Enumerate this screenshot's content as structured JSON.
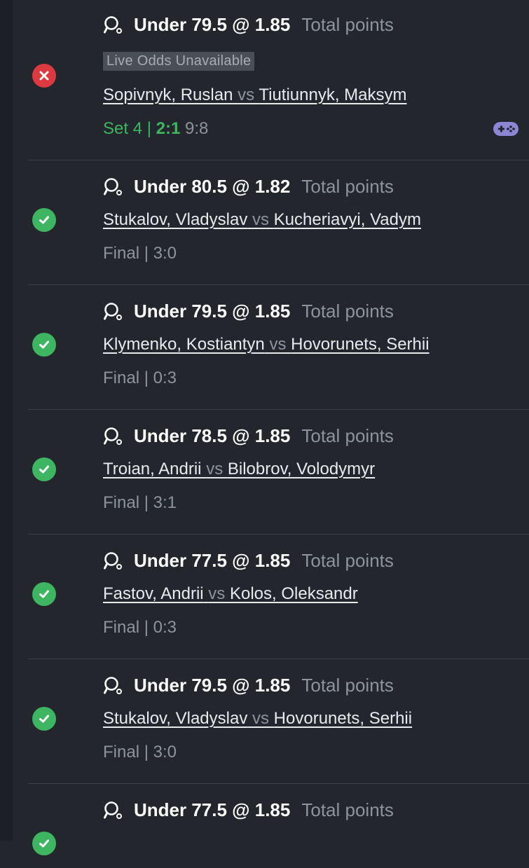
{
  "colors": {
    "won": "#3db561",
    "lost": "#dc3a40",
    "background": "#23262d"
  },
  "icons": {
    "sport": "table-tennis-icon",
    "won": "check-icon",
    "lost": "x-icon",
    "live": "gamepad-icon"
  },
  "bets": [
    {
      "status": "lost",
      "bet": "Under 79.5 @ 1.85",
      "market": "Total points",
      "badge": "Live Odds Unavailable",
      "player1": "Sopivnyk, Ruslan",
      "vs": "vs",
      "player2": "Tiutiunnyk, Maksym",
      "score_prefix": "Set 4 | ",
      "score_sets": "2:1",
      "score_points": " 9:8"
    },
    {
      "status": "won",
      "bet": "Under 80.5 @ 1.82",
      "market": "Total points",
      "player1": "Stukalov, Vladyslav",
      "vs": "vs",
      "player2": "Kucheriavyi, Vadym",
      "score": "Final | 3:0"
    },
    {
      "status": "won",
      "bet": "Under 79.5 @ 1.85",
      "market": "Total points",
      "player1": "Klymenko, Kostiantyn",
      "vs": "vs",
      "player2": "Hovorunets, Serhii",
      "score": "Final | 0:3"
    },
    {
      "status": "won",
      "bet": "Under 78.5 @ 1.85",
      "market": "Total points",
      "player1": "Troian, Andrii",
      "vs": "vs",
      "player2": "Bilobrov, Volodymyr",
      "score": "Final | 3:1"
    },
    {
      "status": "won",
      "bet": "Under 77.5 @ 1.85",
      "market": "Total points",
      "player1": "Fastov, Andrii",
      "vs": "vs",
      "player2": "Kolos, Oleksandr",
      "score": "Final | 0:3"
    },
    {
      "status": "won",
      "bet": "Under 79.5 @ 1.85",
      "market": "Total points",
      "player1": "Stukalov, Vladyslav",
      "vs": "vs",
      "player2": "Hovorunets, Serhii",
      "score": "Final | 3:0"
    },
    {
      "status": "won",
      "bet": "Under 77.5 @ 1.85",
      "market": "Total points"
    }
  ]
}
